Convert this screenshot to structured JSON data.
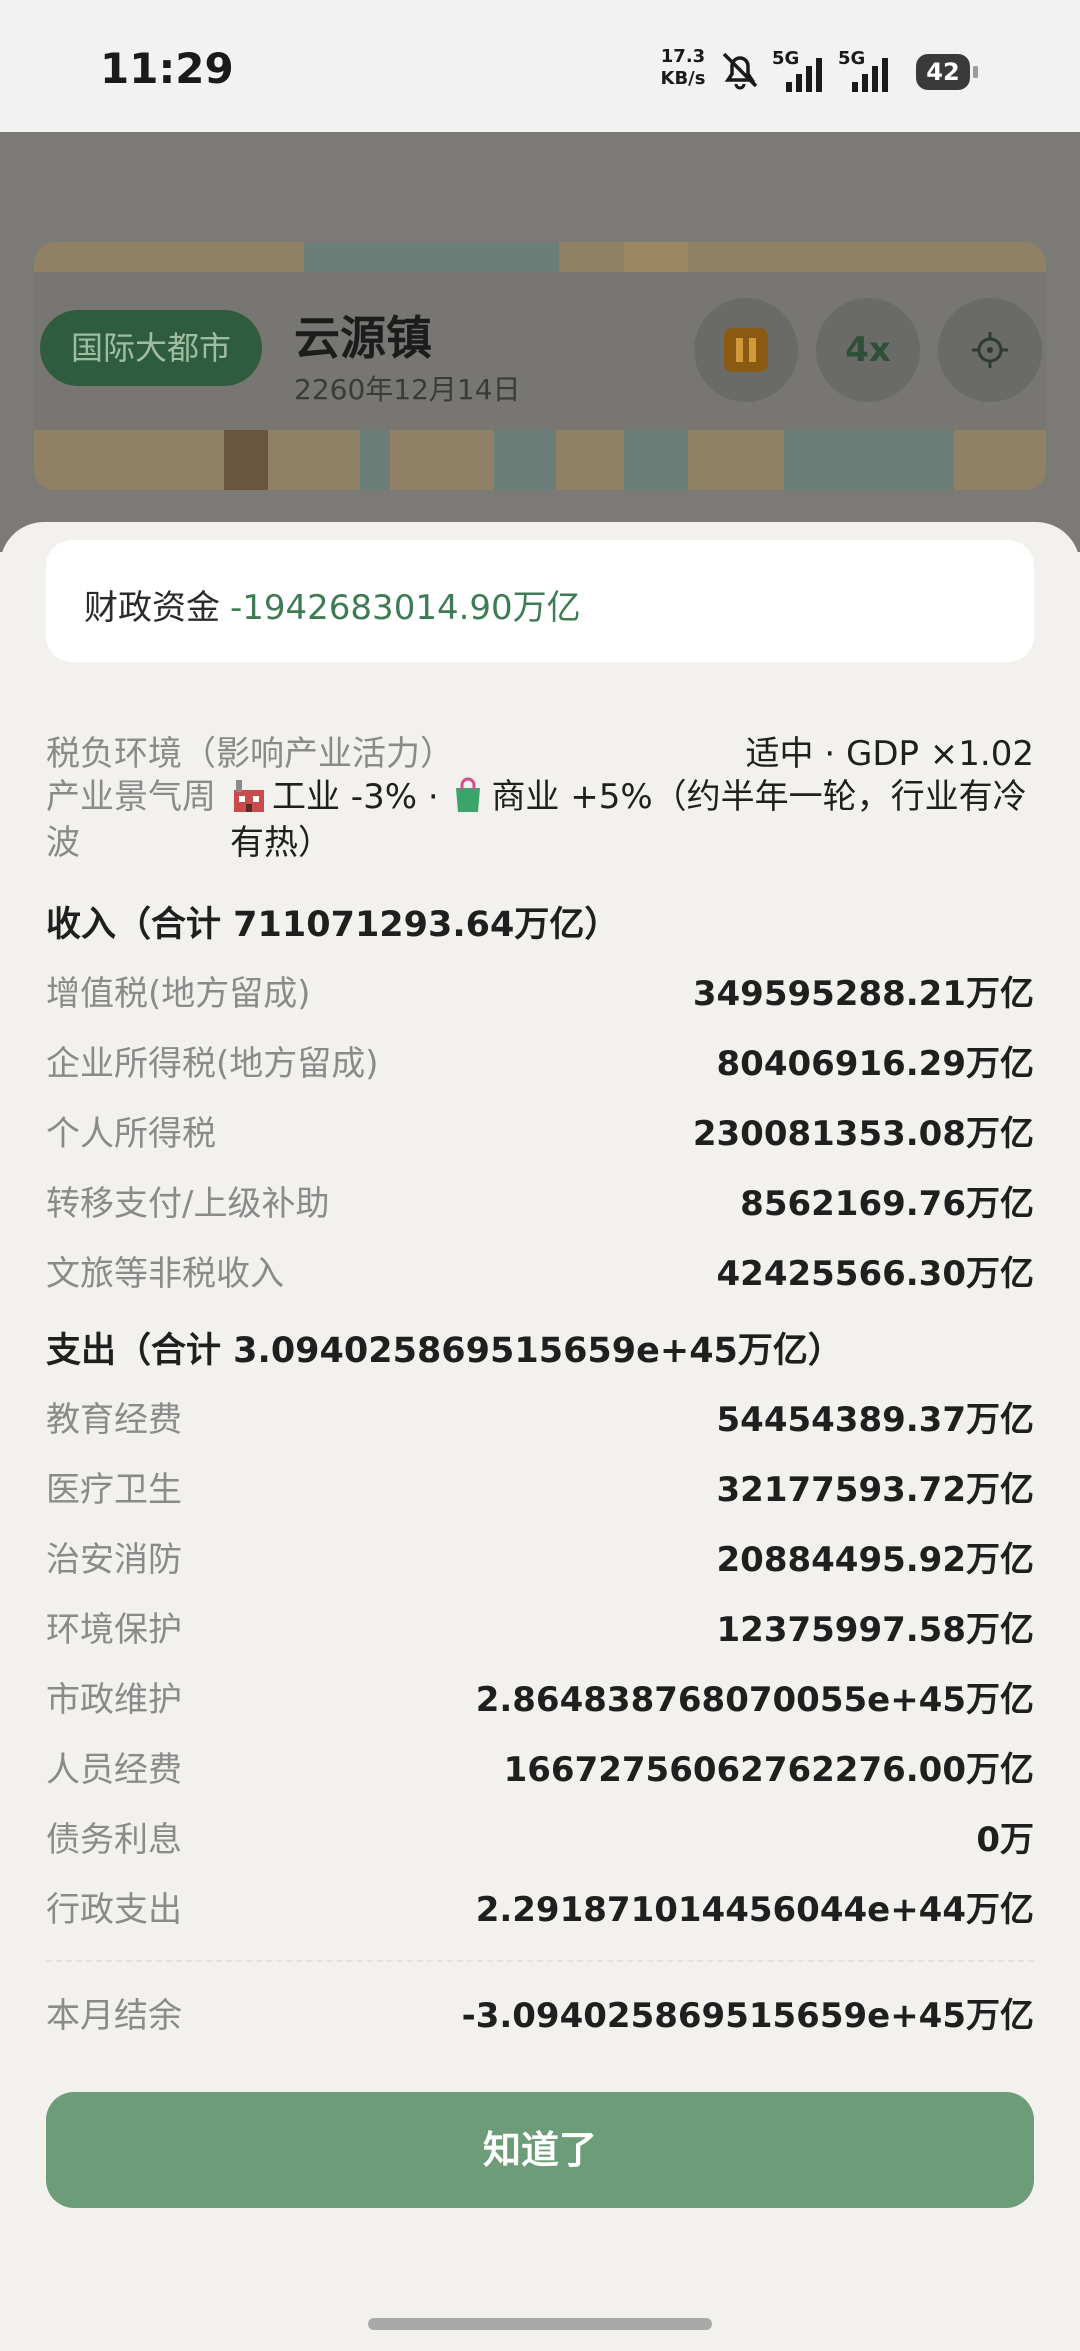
{
  "status_bar": {
    "time": "11:29",
    "net_speed_value": "17.3",
    "net_speed_unit": "KB/s",
    "signal_1": "5G",
    "signal_2": "5G",
    "battery": "42"
  },
  "game": {
    "city_level": "国际大都市",
    "town_name": "云源镇",
    "date": "2260年12月14日",
    "speed": "4x",
    "icons": [
      "more-icon",
      "close-target-icon",
      "pause-icon",
      "settings-icon"
    ]
  },
  "sheet": {
    "funds_label": "财政资金",
    "funds_value": "-1942683014.90万亿",
    "tax_env_label": "税负环境（影响产业活力）",
    "tax_env_value": "适中 · GDP ×1.02",
    "cycle_label": "产业景气周波",
    "cycle_industry": "工业 -3% · ",
    "cycle_commerce": "商业 +5%（约半年一轮，行业有冷有热）",
    "income_title": "收入（合计 711071293.64万亿）",
    "income": [
      {
        "label": "增值税(地方留成)",
        "value": "349595288.21万亿"
      },
      {
        "label": "企业所得税(地方留成)",
        "value": "80406916.29万亿"
      },
      {
        "label": "个人所得税",
        "value": "230081353.08万亿"
      },
      {
        "label": "转移支付/上级补助",
        "value": "8562169.76万亿"
      },
      {
        "label": "文旅等非税收入",
        "value": "42425566.30万亿"
      }
    ],
    "expense_title": "支出（合计 3.094025869515659e+45万亿）",
    "expense": [
      {
        "label": "教育经费",
        "value": "54454389.37万亿"
      },
      {
        "label": "医疗卫生",
        "value": "32177593.72万亿"
      },
      {
        "label": "治安消防",
        "value": "20884495.92万亿"
      },
      {
        "label": "环境保护",
        "value": "12375997.58万亿"
      },
      {
        "label": "市政维护",
        "value": "2.864838768070055e+45万亿"
      },
      {
        "label": "人员经费",
        "value": "16672756062762276.00万亿"
      },
      {
        "label": "债务利息",
        "value": "0万"
      },
      {
        "label": "行政支出",
        "value": "2.291871014456044e+44万亿"
      }
    ],
    "balance_label": "本月结余",
    "balance_value": "-3.094025869515659e+45万亿",
    "ok_button": "知道了"
  },
  "colors": {
    "accent_green": "#6d9c78",
    "funds_green": "#3f7b54",
    "sheet_bg": "#f2f1ee"
  }
}
